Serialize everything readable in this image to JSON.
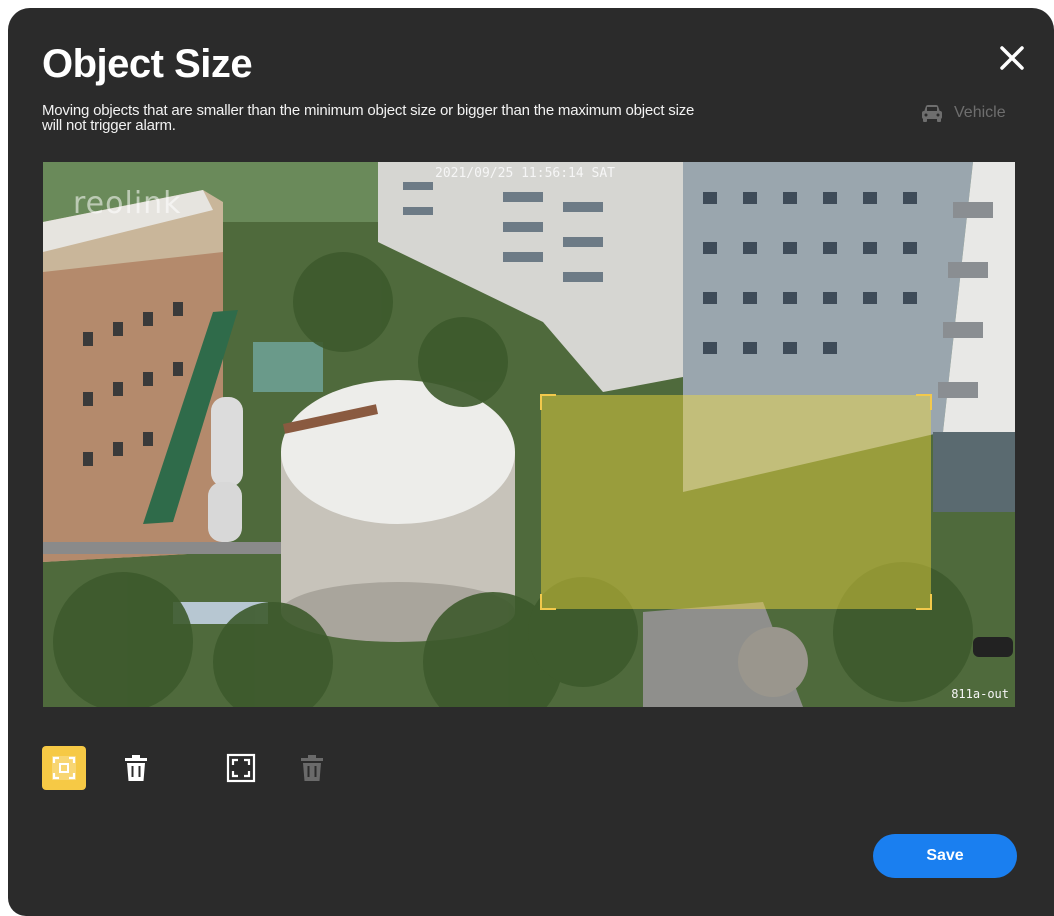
{
  "dialog": {
    "title": "Object Size",
    "description_line1": "Moving objects that are smaller than the minimum object size or bigger than the maximum object size",
    "description_line2": "will not trigger alarm.",
    "close_icon": "close-icon"
  },
  "object_type": {
    "label": "Vehicle",
    "icon": "car-icon",
    "state": "disabled"
  },
  "video": {
    "watermark": "reolink",
    "timestamp": "2021/09/25 11:56:14 SAT",
    "camera_name": "811a-out",
    "zone_color": "#f5dc3c"
  },
  "toolbar": {
    "min_size_tool": {
      "icon": "min-size-icon",
      "active": true
    },
    "delete_min_tool": {
      "icon": "trash-icon"
    },
    "max_size_tool": {
      "icon": "max-size-icon",
      "active": false
    },
    "delete_max_tool": {
      "icon": "trash-icon",
      "disabled": true
    }
  },
  "actions": {
    "save_label": "Save",
    "save_color": "#1a7ff0"
  },
  "colors": {
    "background": "#2b2b2b",
    "accent_yellow": "#f6c945"
  }
}
